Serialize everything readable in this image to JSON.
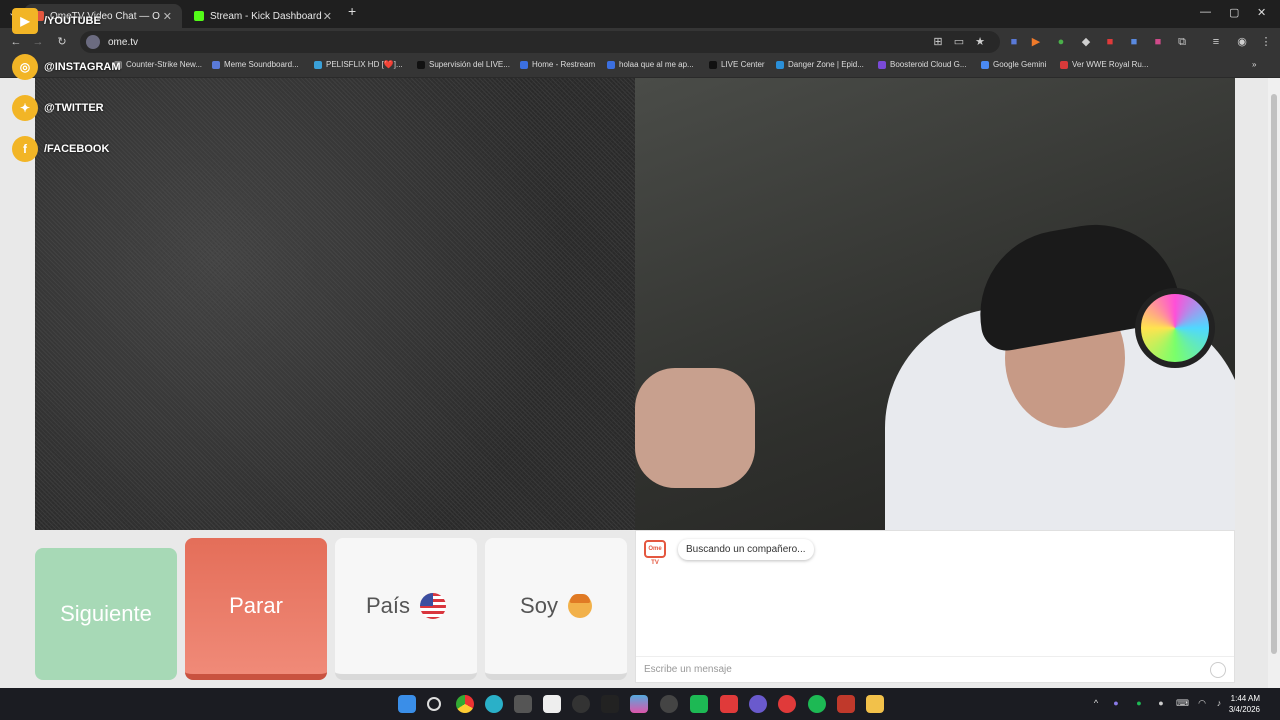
{
  "browser": {
    "tabs": [
      {
        "title": "OmeTV Video Chat — Ome",
        "active": true,
        "favicon_color": "#e4573f"
      },
      {
        "title": "Stream - Kick Dashboard",
        "active": false,
        "favicon_color": "#53fc18"
      }
    ],
    "new_tab": "+",
    "url": "ome.tv",
    "window_controls": {
      "minimize": "—",
      "maximize": "▢",
      "close": "✕"
    }
  },
  "bookmarks": [
    {
      "label": "Counter-Strike New...",
      "icon_color": "#888888"
    },
    {
      "label": "Meme Soundboard...",
      "icon_color": "#5a7ad8"
    },
    {
      "label": "PELISFLIX HD [❤️]...",
      "icon_color": "#3aa0d8"
    },
    {
      "label": "Supervisión del LIVE...",
      "icon_color": "#111111"
    },
    {
      "label": "Home - Restream",
      "icon_color": "#3b6fe0"
    },
    {
      "label": "holaa que al me ap...",
      "icon_color": "#3b6fe0"
    },
    {
      "label": "LIVE Center",
      "icon_color": "#111111"
    },
    {
      "label": "Danger Zone | Epid...",
      "icon_color": "#2a8fd8"
    },
    {
      "label": "Boosteroid Cloud G...",
      "icon_color": "#7a4ad8"
    },
    {
      "label": "Google Gemini",
      "icon_color": "#4a8af4"
    },
    {
      "label": "Ver WWE Royal Ru...",
      "icon_color": "#d83a3a"
    }
  ],
  "social": {
    "youtube": "/YOUTUBE",
    "instagram": "@INSTAGRAM",
    "twitter": "@TWITTER",
    "facebook": "/FACEBOOK"
  },
  "controls": {
    "next": "Siguiente",
    "stop": "Parar",
    "country": "País",
    "i_am": "Soy"
  },
  "chat": {
    "logo_text": "Ome TV",
    "status": "Buscando un compañero...",
    "input_placeholder": "Escribe un mensaje"
  },
  "taskbar": {
    "time": "1:44 AM",
    "date": "3/4/2026"
  }
}
